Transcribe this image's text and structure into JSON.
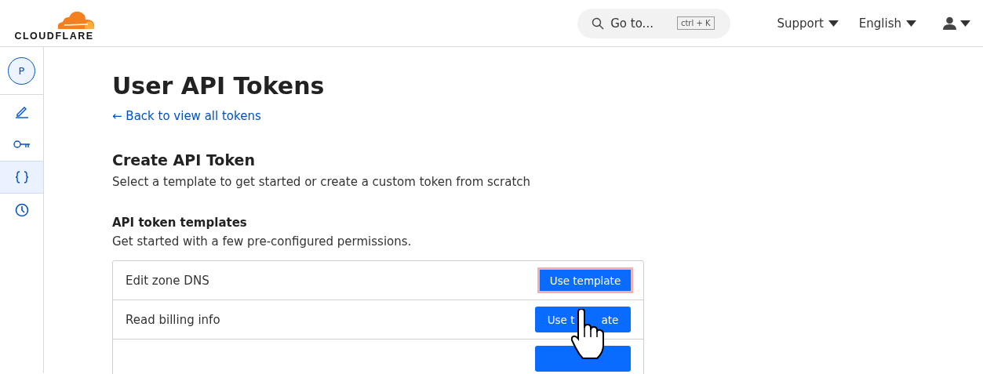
{
  "header": {
    "logo_text": "CLOUDFLARE",
    "search": {
      "placeholder": "Go to...",
      "shortcut": "ctrl + K"
    },
    "menus": [
      {
        "label": "Support"
      },
      {
        "label": "English"
      }
    ]
  },
  "sidebar": {
    "account_initial": "P",
    "items": [
      {
        "kind": "edit",
        "selected": false
      },
      {
        "kind": "key",
        "selected": false
      },
      {
        "kind": "code",
        "selected": true
      },
      {
        "kind": "clock",
        "selected": false
      }
    ]
  },
  "page": {
    "title": "User API Tokens",
    "back_link": "← Back to view all tokens",
    "section_title": "Create API Token",
    "section_text": "Select a template to get started or create a custom token from scratch",
    "templates_title": "API token templates",
    "templates_text": "Get started with a few pre-configured permissions."
  },
  "templates": [
    {
      "name": "Edit zone DNS",
      "button": [
        "Use template"
      ],
      "focused": true
    },
    {
      "name": "Read billing info",
      "button": [
        "Use t",
        "ate"
      ],
      "focused": false
    },
    {
      "focused": false
    }
  ],
  "cursor": {
    "kind": "hand"
  }
}
